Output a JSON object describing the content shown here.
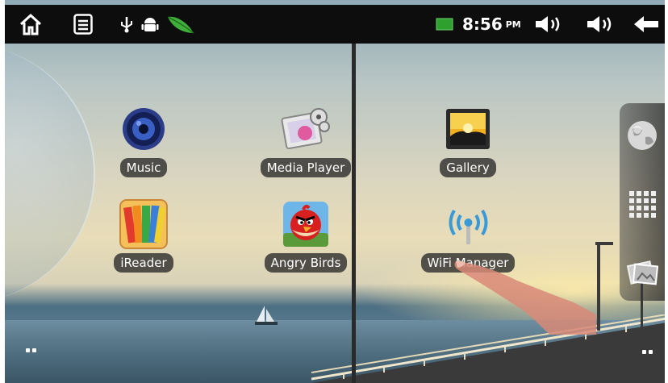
{
  "status_bar": {
    "icons_left": [
      "home-icon",
      "menu-icon",
      "usb-icon",
      "android-debug-icon",
      "leaf-icon"
    ],
    "battery_icon": "battery-icon",
    "time": "8:56",
    "ampm": "PM",
    "icons_right": [
      "volume-down-icon",
      "volume-up-icon",
      "back-arrow-icon"
    ]
  },
  "apps": [
    {
      "label": "Music",
      "icon": "speaker-icon"
    },
    {
      "label": "Media Player",
      "icon": "media-player-icon"
    },
    {
      "label": "Gallery",
      "icon": "gallery-icon"
    },
    {
      "label": "iReader",
      "icon": "ireader-icon"
    },
    {
      "label": "Angry Birds",
      "icon": "angry-bird-icon"
    },
    {
      "label": "WiFi Manager",
      "icon": "wifi-icon"
    }
  ],
  "dock": [
    "browser-globe-icon",
    "app-drawer-grid-icon",
    "photos-icon"
  ],
  "colors": {
    "status_bar": "#0d0d0d",
    "label_bg": "#282828"
  }
}
